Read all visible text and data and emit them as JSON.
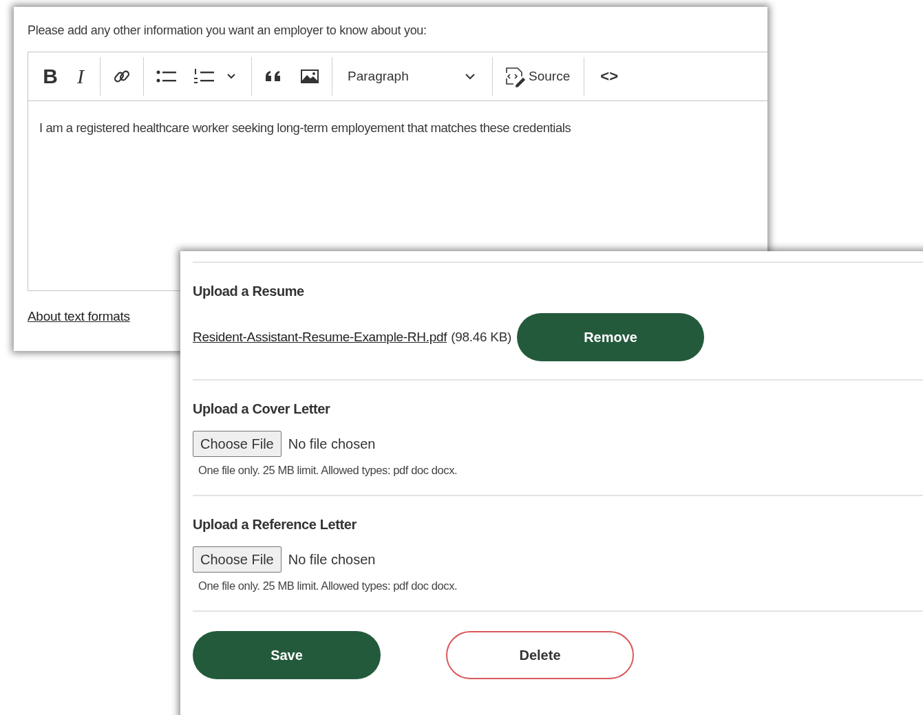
{
  "editor_panel": {
    "prompt": "Please add any other information you want an employer to know about you:",
    "toolbar": [
      {
        "kind": "bold",
        "text": "B"
      },
      {
        "kind": "italic",
        "text": "I"
      },
      {
        "kind": "separator"
      },
      {
        "kind": "link"
      },
      {
        "kind": "separator"
      },
      {
        "kind": "bullet-list"
      },
      {
        "kind": "numbered-list"
      },
      {
        "kind": "separator"
      },
      {
        "kind": "quote"
      },
      {
        "kind": "image"
      },
      {
        "kind": "separator"
      },
      {
        "kind": "heading",
        "text": "Paragraph"
      },
      {
        "kind": "separator"
      },
      {
        "kind": "source",
        "text": "Source"
      },
      {
        "kind": "separator"
      },
      {
        "kind": "code",
        "text": "<>"
      }
    ],
    "content": "I am a registered healthcare worker seeking long-term employement that matches these credentials",
    "formats_link": "About text formats"
  },
  "upload_panel": {
    "sections": [
      {
        "kind": "attached",
        "title": "Upload a Resume",
        "file_link": "Resident-Assistant-Resume-Example-RH.pdf",
        "file_size": "(98.46 KB)",
        "button": "Remove"
      },
      {
        "kind": "input",
        "title": "Upload a Cover Letter",
        "button": "Choose File",
        "status": "No file chosen",
        "hint": "One file only. 25 MB limit. Allowed types: pdf doc docx."
      },
      {
        "kind": "input",
        "title": "Upload a Reference Letter",
        "button": "Choose File",
        "status": "No file chosen",
        "hint": "One file only. 25 MB limit. Allowed types: pdf doc docx."
      }
    ],
    "actions": [
      {
        "kind": "primary",
        "label": "Save"
      },
      {
        "kind": "outline",
        "label": "Delete"
      }
    ]
  }
}
